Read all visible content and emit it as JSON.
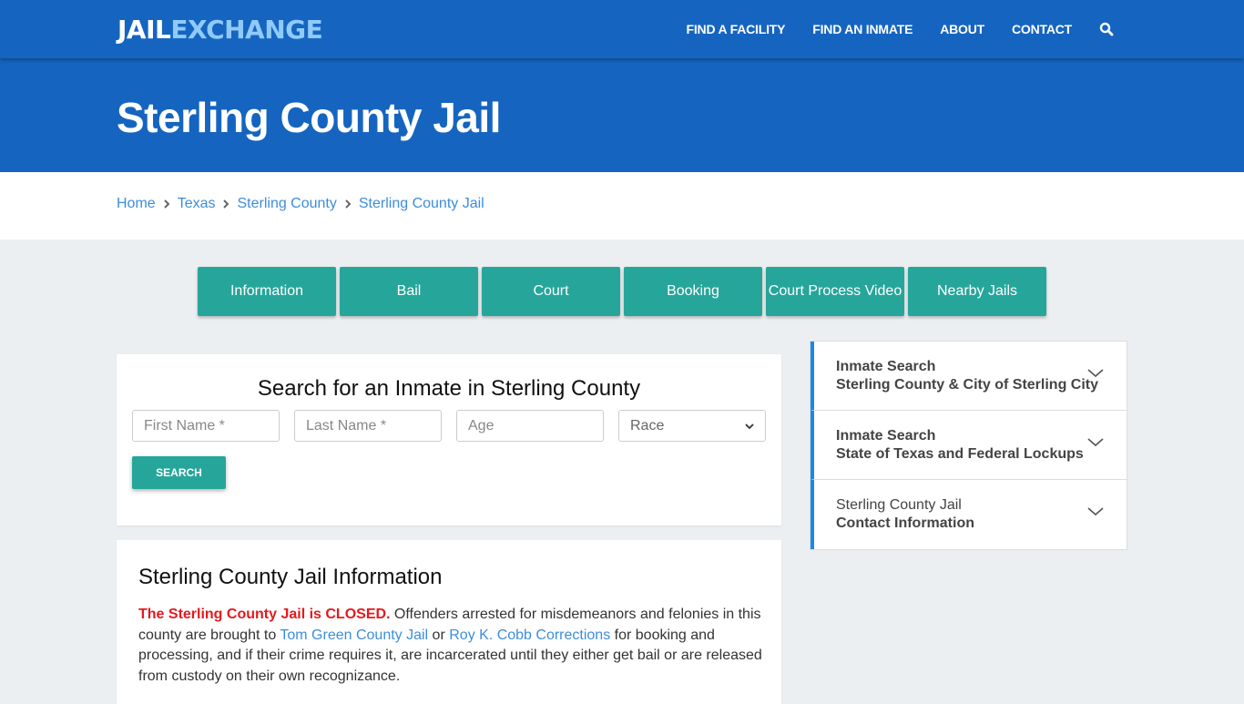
{
  "brand": {
    "logo_part1": "JAIL",
    "logo_part2": "EXCHANGE"
  },
  "nav": {
    "links": [
      "FIND A FACILITY",
      "FIND AN INMATE",
      "ABOUT",
      "CONTACT"
    ],
    "search_icon": "search-icon"
  },
  "page": {
    "title": "Sterling County Jail"
  },
  "breadcrumb": [
    "Home",
    "Texas",
    "Sterling County",
    "Sterling County Jail"
  ],
  "tabs": [
    "Information",
    "Bail",
    "Court",
    "Booking",
    "Court Process Video",
    "Nearby Jails"
  ],
  "search": {
    "title": "Search for an Inmate in Sterling County",
    "first_name_placeholder": "First Name *",
    "last_name_placeholder": "Last Name *",
    "age_placeholder": "Age",
    "race_selected": "Race",
    "button": "SEARCH"
  },
  "info": {
    "title": "Sterling County Jail Information",
    "closed_text": "The Sterling County Jail is CLOSED.",
    "text1": " Offenders arrested for misdemeanors and felonies in this county are brought to ",
    "link1": "Tom Green County Jail",
    "text2": " or ",
    "link2": "Roy K. Cobb Corrections",
    "text3": " for booking and processing, and if their crime requires it, are incarcerated until they either get bail or are released from custody on their own recognizance."
  },
  "sidebar": {
    "items": [
      {
        "line1": "Inmate Search",
        "line2": "Sterling County & City of Sterling City"
      },
      {
        "line1": "Inmate Search",
        "line2": "State of Texas and Federal Lockups"
      },
      {
        "line1": "Sterling County Jail",
        "line2": "Contact Information"
      }
    ]
  },
  "colors": {
    "primary": "#1565c0",
    "accent": "#26a69a",
    "link": "#3c8dde",
    "closed": "#e5191e",
    "logo_light": "#90caf9"
  }
}
